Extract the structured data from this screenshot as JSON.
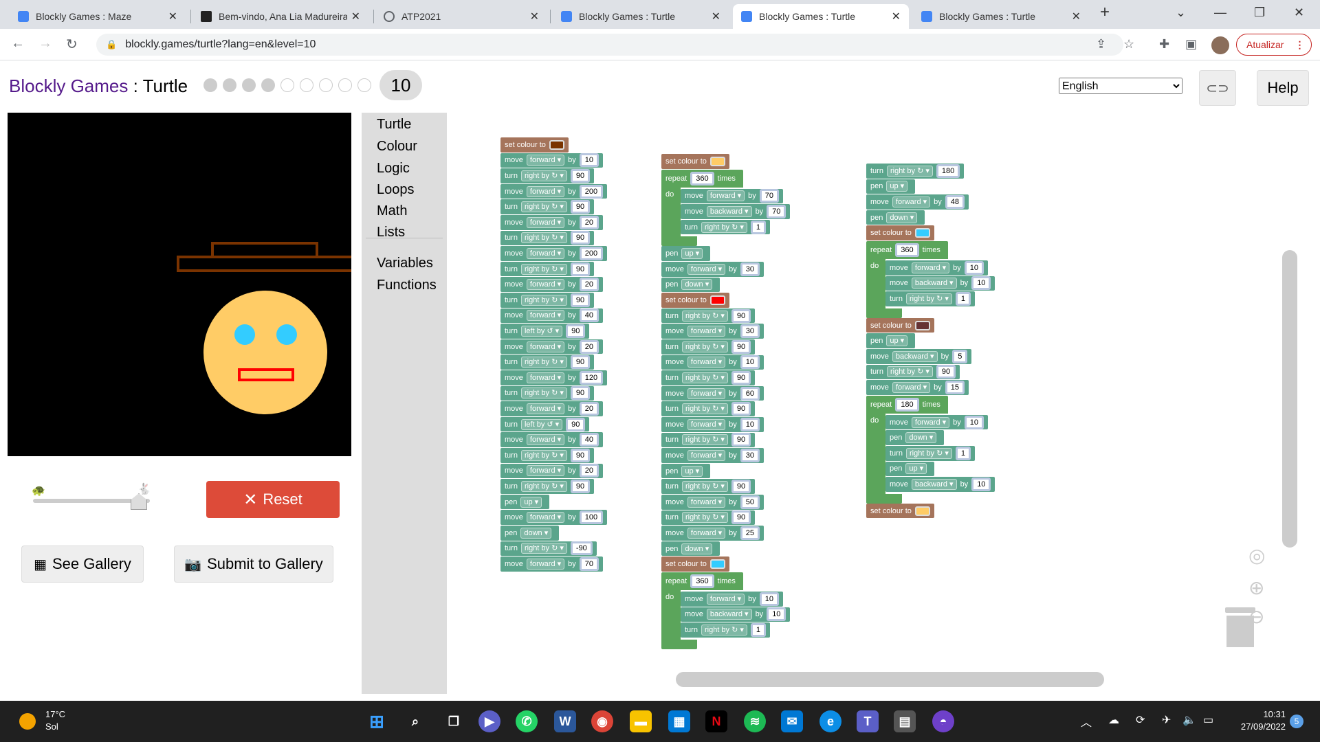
{
  "browser": {
    "tabs": [
      {
        "title": "Blockly Games : Maze",
        "active": false
      },
      {
        "title": "Bem-vindo, Ana Lia Madureira",
        "active": false
      },
      {
        "title": "ATP2021",
        "active": false
      },
      {
        "title": "Blockly Games : Turtle",
        "active": false
      },
      {
        "title": "Blockly Games : Turtle",
        "active": true
      },
      {
        "title": "Blockly Games : Turtle",
        "active": false
      }
    ],
    "url": "blockly.games/turtle?lang=en&level=10",
    "update_label": "Atualizar"
  },
  "header": {
    "brand": "Blockly Games",
    "separator": " : ",
    "game": "Turtle",
    "levels_completed": 4,
    "levels_total": 9,
    "current_level": "10",
    "language": "English",
    "language_options": [
      "English"
    ],
    "help_label": "Help"
  },
  "controls": {
    "reset_label": "Reset",
    "gallery_label": "See Gallery",
    "submit_label": "Submit to Gallery"
  },
  "toolbox": {
    "categories": [
      "Turtle",
      "Colour",
      "Logic",
      "Loops",
      "Math",
      "Lists"
    ],
    "categories2": [
      "Variables",
      "Functions"
    ]
  },
  "colors": {
    "turtle_block": "#5ba58c",
    "colour_block": "#a5745b",
    "loop_block": "#5ba55b",
    "reset_button": "#dd4b39",
    "brand": "#551a8b",
    "swatch_brown": "#7a3300",
    "swatch_orange": "#ffcc66",
    "swatch_red": "#ff0000",
    "swatch_cyan": "#33ccff",
    "swatch_darkred": "#663333"
  },
  "program": {
    "column1": [
      {
        "k": "colour",
        "c": "#7a3300"
      },
      {
        "k": "move",
        "d": "forward",
        "v": "10"
      },
      {
        "k": "turn",
        "d": "right by ↻",
        "v": "90"
      },
      {
        "k": "move",
        "d": "forward",
        "v": "200"
      },
      {
        "k": "turn",
        "d": "right by ↻",
        "v": "90"
      },
      {
        "k": "move",
        "d": "forward",
        "v": "20"
      },
      {
        "k": "turn",
        "d": "right by ↻",
        "v": "90"
      },
      {
        "k": "move",
        "d": "forward",
        "v": "200"
      },
      {
        "k": "turn",
        "d": "right by ↻",
        "v": "90"
      },
      {
        "k": "move",
        "d": "forward",
        "v": "20"
      },
      {
        "k": "turn",
        "d": "right by ↻",
        "v": "90"
      },
      {
        "k": "move",
        "d": "forward",
        "v": "40"
      },
      {
        "k": "turn",
        "d": "left by ↺",
        "v": "90"
      },
      {
        "k": "move",
        "d": "forward",
        "v": "20"
      },
      {
        "k": "turn",
        "d": "right by ↻",
        "v": "90"
      },
      {
        "k": "move",
        "d": "forward",
        "v": "120"
      },
      {
        "k": "turn",
        "d": "right by ↻",
        "v": "90"
      },
      {
        "k": "move",
        "d": "forward",
        "v": "20"
      },
      {
        "k": "turn",
        "d": "left by ↺",
        "v": "90"
      },
      {
        "k": "move",
        "d": "forward",
        "v": "40"
      },
      {
        "k": "turn",
        "d": "right by ↻",
        "v": "90"
      },
      {
        "k": "move",
        "d": "forward",
        "v": "20"
      },
      {
        "k": "turn",
        "d": "right by ↻",
        "v": "90"
      },
      {
        "k": "pen",
        "d": "up"
      },
      {
        "k": "move",
        "d": "forward",
        "v": "100"
      },
      {
        "k": "pen",
        "d": "down"
      },
      {
        "k": "turn",
        "d": "right by ↻",
        "v": "-90"
      },
      {
        "k": "move",
        "d": "forward",
        "v": "70"
      }
    ],
    "column2": [
      {
        "k": "colour",
        "c": "#ffcc66"
      },
      {
        "k": "repeat",
        "v": "360",
        "body": [
          {
            "k": "move",
            "d": "forward",
            "v": "70"
          },
          {
            "k": "move",
            "d": "backward",
            "v": "70"
          },
          {
            "k": "turn",
            "d": "right by ↻",
            "v": "1"
          }
        ]
      },
      {
        "k": "pen",
        "d": "up"
      },
      {
        "k": "move",
        "d": "forward",
        "v": "30"
      },
      {
        "k": "pen",
        "d": "down"
      },
      {
        "k": "colour",
        "c": "#ff0000"
      },
      {
        "k": "turn",
        "d": "right by ↻",
        "v": "90"
      },
      {
        "k": "move",
        "d": "forward",
        "v": "30"
      },
      {
        "k": "turn",
        "d": "right by ↻",
        "v": "90"
      },
      {
        "k": "move",
        "d": "forward",
        "v": "10"
      },
      {
        "k": "turn",
        "d": "right by ↻",
        "v": "90"
      },
      {
        "k": "move",
        "d": "forward",
        "v": "60"
      },
      {
        "k": "turn",
        "d": "right by ↻",
        "v": "90"
      },
      {
        "k": "move",
        "d": "forward",
        "v": "10"
      },
      {
        "k": "turn",
        "d": "right by ↻",
        "v": "90"
      },
      {
        "k": "move",
        "d": "forward",
        "v": "30"
      },
      {
        "k": "pen",
        "d": "up"
      },
      {
        "k": "turn",
        "d": "right by ↻",
        "v": "90"
      },
      {
        "k": "move",
        "d": "forward",
        "v": "50"
      },
      {
        "k": "turn",
        "d": "right by ↻",
        "v": "90"
      },
      {
        "k": "move",
        "d": "forward",
        "v": "25"
      },
      {
        "k": "pen",
        "d": "down"
      },
      {
        "k": "colour",
        "c": "#33ccff"
      },
      {
        "k": "repeat",
        "v": "360",
        "body": [
          {
            "k": "move",
            "d": "forward",
            "v": "10"
          },
          {
            "k": "move",
            "d": "backward",
            "v": "10"
          },
          {
            "k": "turn",
            "d": "right by ↻",
            "v": "1"
          }
        ]
      }
    ],
    "column3": [
      {
        "k": "turn",
        "d": "right by ↻",
        "v": "180"
      },
      {
        "k": "pen",
        "d": "up"
      },
      {
        "k": "move",
        "d": "forward",
        "v": "48"
      },
      {
        "k": "pen",
        "d": "down"
      },
      {
        "k": "colour",
        "c": "#33ccff"
      },
      {
        "k": "repeat",
        "v": "360",
        "body": [
          {
            "k": "move",
            "d": "forward",
            "v": "10"
          },
          {
            "k": "move",
            "d": "backward",
            "v": "10"
          },
          {
            "k": "turn",
            "d": "right by ↻",
            "v": "1"
          }
        ]
      },
      {
        "k": "colour",
        "c": "#663333"
      },
      {
        "k": "pen",
        "d": "up"
      },
      {
        "k": "move",
        "d": "backward",
        "v": "5"
      },
      {
        "k": "turn",
        "d": "right by ↻",
        "v": "90"
      },
      {
        "k": "move",
        "d": "forward",
        "v": "15"
      },
      {
        "k": "repeat",
        "v": "180",
        "body": [
          {
            "k": "move",
            "d": "forward",
            "v": "10"
          },
          {
            "k": "pen",
            "d": "down"
          },
          {
            "k": "turn",
            "d": "right by ↻",
            "v": "1"
          },
          {
            "k": "pen",
            "d": "up"
          },
          {
            "k": "move",
            "d": "backward",
            "v": "10"
          }
        ]
      },
      {
        "k": "colour",
        "c": "#ffcc66"
      }
    ],
    "labels": {
      "move": "move",
      "by": "by",
      "turn": "turn",
      "pen": "pen",
      "colour": "set colour to",
      "repeat": "repeat",
      "times": "times",
      "do": "do"
    }
  },
  "taskbar": {
    "temperature": "17°C",
    "weather": "Sol",
    "time": "10:31",
    "date": "27/09/2022",
    "notifications": "5"
  }
}
